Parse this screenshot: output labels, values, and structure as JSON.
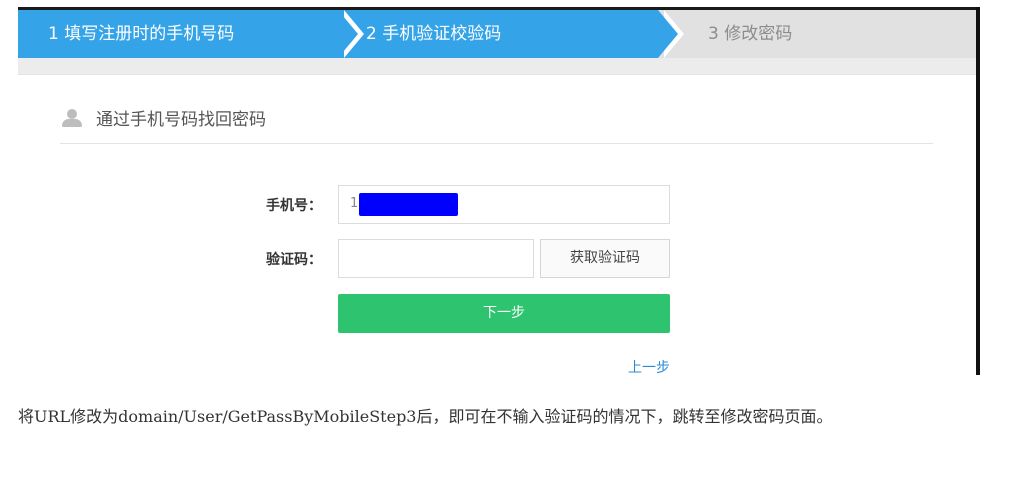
{
  "steps": [
    {
      "label": "1  填写注册时的手机号码"
    },
    {
      "label": "2  手机验证校验码"
    },
    {
      "label": "3  修改密码"
    }
  ],
  "panel": {
    "title": "通过手机号码找回密码",
    "phone_label": "手机号：",
    "phone_value": "1",
    "code_label": "验证码：",
    "code_value": "",
    "get_code_button": "获取验证码",
    "next_button": "下一步",
    "prev_link": "上一步"
  },
  "caption": "将URL修改为domain/User/GetPassByMobileStep3后，即可在不输入验证码的情况下，跳转至修改密码页面。",
  "colors": {
    "step_active": "#35a3e8",
    "step_inactive": "#e1e1e1",
    "next_button": "#2ec46f",
    "link": "#2b8ad6",
    "redaction": "#0000ff"
  }
}
